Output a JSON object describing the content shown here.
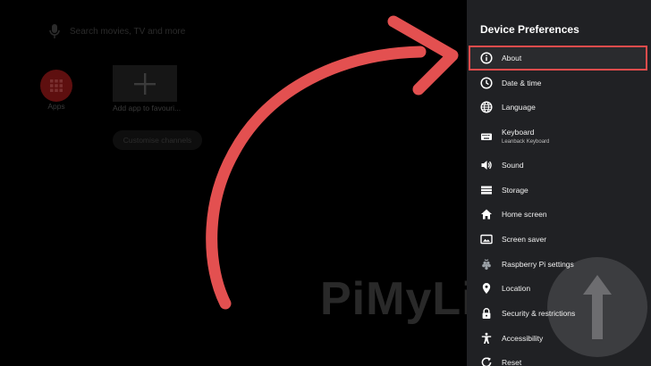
{
  "home": {
    "search_placeholder": "Search movies, TV and more",
    "apps_label": "Apps",
    "add_app_label": "Add app to favouri...",
    "customise_label": "Customise channels"
  },
  "panel": {
    "title": "Device Preferences",
    "items": [
      {
        "label": "About",
        "icon": "info-icon",
        "selected": true
      },
      {
        "label": "Date & time",
        "icon": "clock-icon"
      },
      {
        "label": "Language",
        "icon": "globe-icon"
      },
      {
        "label": "Keyboard",
        "sub": "Leanback Keyboard",
        "icon": "keyboard-icon"
      },
      {
        "label": "Sound",
        "icon": "speaker-icon"
      },
      {
        "label": "Storage",
        "icon": "storage-icon"
      },
      {
        "label": "Home screen",
        "icon": "home-icon"
      },
      {
        "label": "Screen saver",
        "icon": "screen-saver-icon"
      },
      {
        "label": "Raspberry Pi settings",
        "icon": "raspberry-icon"
      },
      {
        "label": "Location",
        "icon": "location-pin-icon"
      },
      {
        "label": "Security & restrictions",
        "icon": "lock-icon"
      },
      {
        "label": "Accessibility",
        "icon": "accessibility-icon"
      },
      {
        "label": "Reset",
        "icon": "reset-icon"
      }
    ]
  },
  "watermark": {
    "text": "PiMyLife"
  },
  "colors": {
    "accent": "#e84c4c",
    "panel_bg": "#202124"
  }
}
